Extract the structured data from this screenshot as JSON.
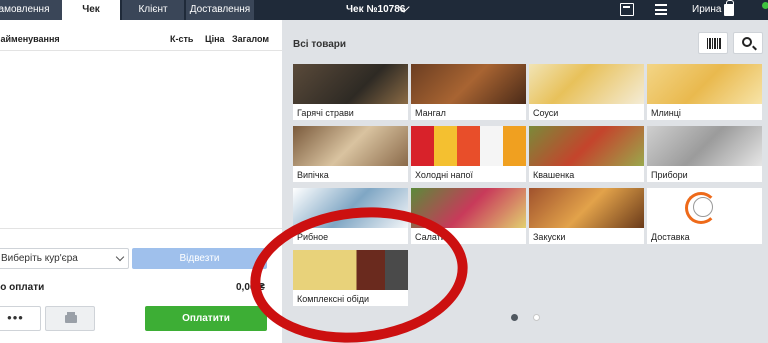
{
  "topbar": {
    "tabs": [
      {
        "label": "Замовлення",
        "state": "dark"
      },
      {
        "label": "Чек",
        "state": "active"
      },
      {
        "label": "Клієнт",
        "state": "dark"
      },
      {
        "label": "Доставлення",
        "state": "dark"
      }
    ],
    "title": "Чек №10786",
    "user": "Ирина",
    "status_color": "#3ec33e"
  },
  "receipt": {
    "columns": [
      "Найменування",
      "К-сть",
      "Ціна",
      "Загалом"
    ],
    "courier_placeholder": "Виберіть кур'єра",
    "deliver_label": "Відвезти",
    "to_pay_label": "До оплати",
    "to_pay_value": "0,00 ₴",
    "more_label": "•••",
    "pay_label": "Оплатити"
  },
  "catalog": {
    "title": "Всі товари",
    "categories": [
      {
        "label": "Гарячі страви",
        "bg": "linear-gradient(135deg,#5a4a3a,#2e2a24 60%,#8b6b45)"
      },
      {
        "label": "Мангал",
        "bg": "linear-gradient(135deg,#6b3e22,#a86432 50%,#4a2a18)"
      },
      {
        "label": "Соуси",
        "bg": "linear-gradient(135deg,#f1e4b5,#e8c15a 40%,#f4ecd6)"
      },
      {
        "label": "Млинці",
        "bg": "linear-gradient(135deg,#f3d586,#e9b94e 50%,#f7e4a8)"
      },
      {
        "label": "Випічка",
        "bg": "linear-gradient(135deg,#7a5a3c,#d9c3a0 50%,#8a6a4a)"
      },
      {
        "label": "Холодні напої",
        "bg": "linear-gradient(90deg,#d8222a 0 20%,#f4c030 20% 40%,#e84e2a 40% 60%,#f5f5f5 60% 80%,#f0a020 80%)"
      },
      {
        "label": "Квашенка",
        "bg": "linear-gradient(135deg,#7a8a3a,#c4442c 50%,#9aa84c)"
      },
      {
        "label": "Прибори",
        "bg": "linear-gradient(135deg,#cfcfcf,#9b9b9b 50%,#e6e6e6)"
      },
      {
        "label": "Рибное",
        "bg": "linear-gradient(135deg,#ffffff,#7fa6c4 50%,#f4f6f8)"
      },
      {
        "label": "Салати",
        "bg": "linear-gradient(135deg,#5b8a3a,#c83a5a 50%,#e2d070)"
      },
      {
        "label": "Закуски",
        "bg": "linear-gradient(135deg,#a0522d,#e2a24a 50%,#6a3a1a)"
      },
      {
        "label": "Доставка",
        "bg": "#ffffff"
      },
      {
        "label": "Комплексні обіди",
        "bg": "linear-gradient(90deg,#e8d27a 0 55%,#6a2a1e 55% 80%,#4a4a4a 80%)"
      }
    ],
    "page_dots": [
      "#505860",
      "#ffffff"
    ]
  }
}
